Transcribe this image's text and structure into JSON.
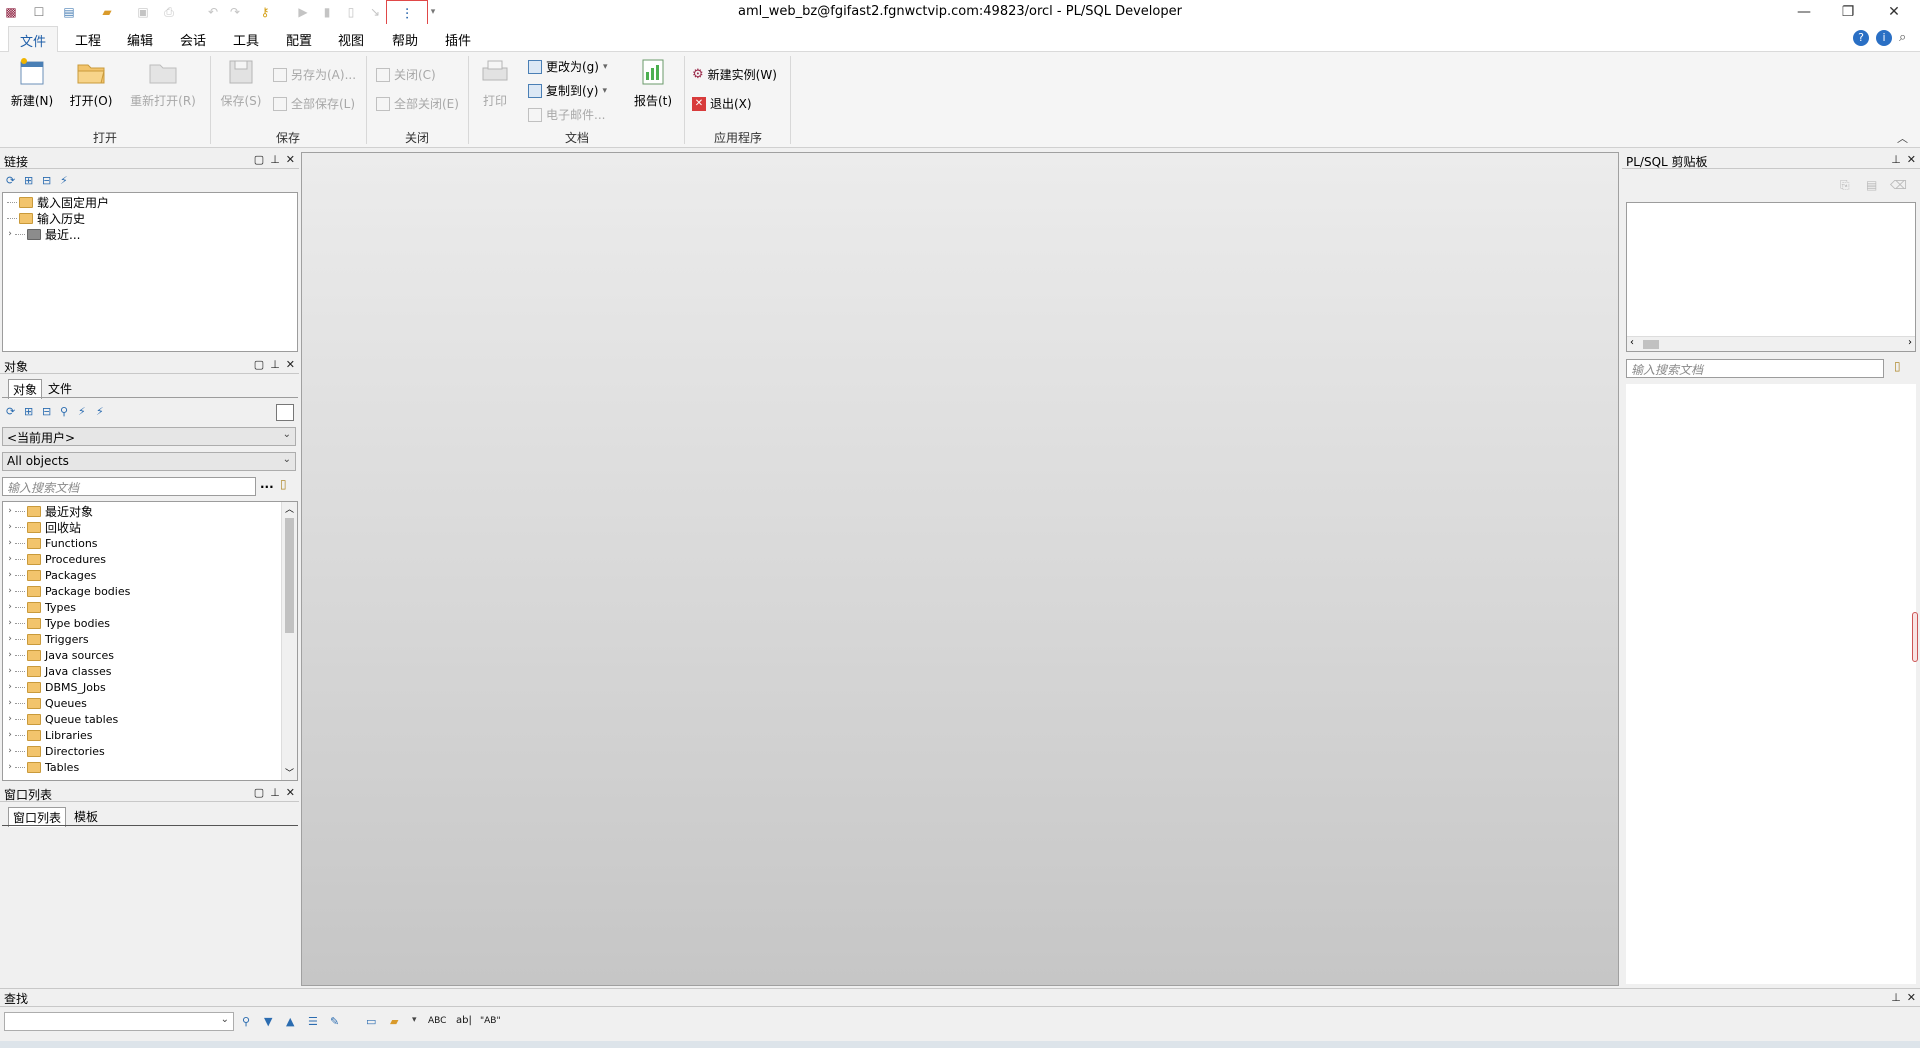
{
  "titlebar": {
    "title": "aml_web_bz@fgifast2.fgnwctvip.com:49823/orcl - PL/SQL Developer",
    "min_icon": "minimize-icon",
    "restore_icon": "restore-icon",
    "close_icon": "close-icon"
  },
  "menu": {
    "tabs": [
      "文件",
      "工程",
      "编辑",
      "会话",
      "工具",
      "配置",
      "视图",
      "帮助",
      "插件"
    ],
    "active": "文件"
  },
  "ribbon": {
    "new_label": "新建(N)",
    "open_label": "打开(O)",
    "reopen_label": "重新打开(R)",
    "save_label": "保存(S)",
    "saveas_label": "另存为(A)...",
    "saveall_label": "全部保存(L)",
    "close_label": "关闭(C)",
    "closeall_label": "全部关闭(E)",
    "print_label": "打印",
    "changeto_label": "更改为(g)",
    "copyto_label": "复制到(y)",
    "email_label": "电子邮件...",
    "report_label": "报告(t)",
    "newinstance_label": "新建实例(W)",
    "exit_label": "退出(X)",
    "groups": {
      "open": "打开",
      "save": "保存",
      "close": "关闭",
      "doc": "文档",
      "app": "应用程序"
    }
  },
  "connection_pane": {
    "title": "链接",
    "items": [
      "载入固定用户",
      "输入历史",
      "最近..."
    ]
  },
  "objects_pane": {
    "title": "对象",
    "tabs": [
      "对象",
      "文件"
    ],
    "user_combo": "<当前用户>",
    "filter_combo": "All objects",
    "search_placeholder": "输入搜索文档",
    "more_label": "...",
    "items": [
      "最近对象",
      "回收站",
      "Functions",
      "Procedures",
      "Packages",
      "Package bodies",
      "Types",
      "Type bodies",
      "Triggers",
      "Java sources",
      "Java classes",
      "DBMS_Jobs",
      "Queues",
      "Queue tables",
      "Libraries",
      "Directories",
      "Tables"
    ]
  },
  "window_list_pane": {
    "title": "窗口列表",
    "tabs": [
      "窗口列表",
      "模板"
    ]
  },
  "clipboard_pane": {
    "title": "PL/SQL 剪贴板",
    "search_placeholder": "输入搜索文档"
  },
  "find_bar": {
    "title": "查找",
    "value": "",
    "abc_label": "ABC",
    "ab_label": "\"AB\""
  }
}
